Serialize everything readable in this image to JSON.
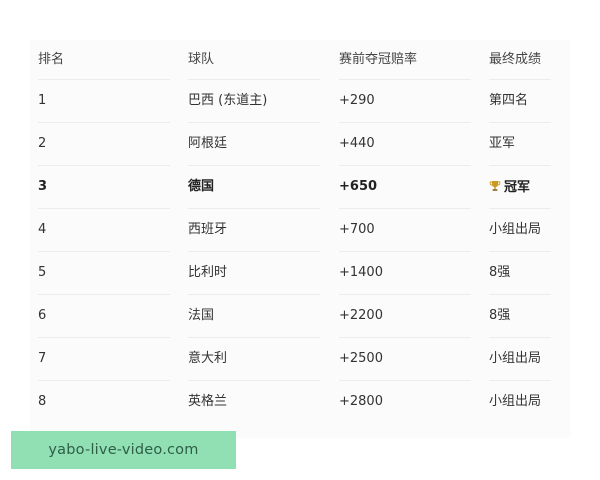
{
  "table": {
    "headers": {
      "rank": "排名",
      "team": "球队",
      "odds": "赛前夺冠赔率",
      "result": "最终成绩"
    },
    "rows": [
      {
        "rank": "1",
        "team": "巴西 (东道主)",
        "odds": "+290",
        "result": "第四名",
        "highlight": false
      },
      {
        "rank": "2",
        "team": "阿根廷",
        "odds": "+440",
        "result": "亚军",
        "highlight": false
      },
      {
        "rank": "3",
        "team": "德国",
        "odds": "+650",
        "result": "冠军",
        "highlight": true,
        "icon": "trophy-icon"
      },
      {
        "rank": "4",
        "team": "西班牙",
        "odds": "+700",
        "result": "小组出局",
        "highlight": false
      },
      {
        "rank": "5",
        "team": "比利时",
        "odds": "+1400",
        "result": "8强",
        "highlight": false
      },
      {
        "rank": "6",
        "team": "法国",
        "odds": "+2200",
        "result": "8强",
        "highlight": false
      },
      {
        "rank": "7",
        "team": "意大利",
        "odds": "+2500",
        "result": "小组出局",
        "highlight": false
      },
      {
        "rank": "8",
        "team": "英格兰",
        "odds": "+2800",
        "result": "小组出局",
        "highlight": false
      }
    ]
  },
  "watermark": {
    "text": "yabo-live-video.com",
    "color": "#90e0b3"
  },
  "colors": {
    "trophy": "#c99a1f"
  }
}
